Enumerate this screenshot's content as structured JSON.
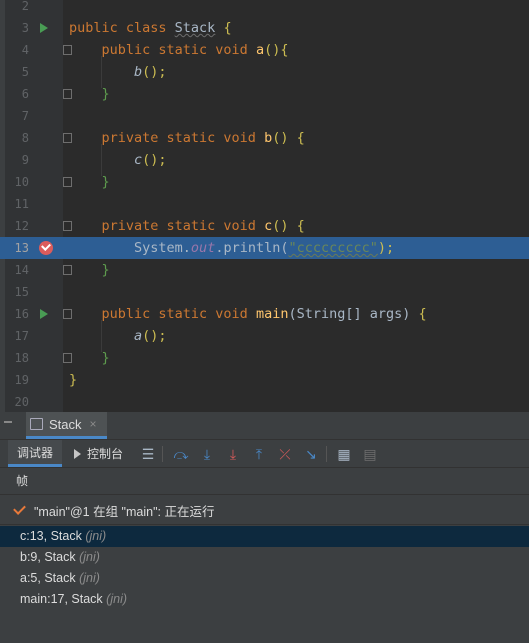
{
  "editor": {
    "lines": [
      {
        "num": "2",
        "tokens": []
      },
      {
        "num": "3",
        "marker": "run",
        "tokens": [
          {
            "t": "public class ",
            "c": "kw"
          },
          {
            "t": "Stack",
            "c": "wavy-cls"
          },
          {
            "t": " {",
            "c": "brace-y"
          }
        ]
      },
      {
        "num": "4",
        "fold": true,
        "tokens": [
          {
            "t": "    public static void ",
            "c": "kw"
          },
          {
            "t": "a",
            "c": "fn"
          },
          {
            "t": "(){",
            "c": "brace-y"
          }
        ]
      },
      {
        "num": "5",
        "tokens": [
          {
            "t": "        "
          },
          {
            "t": "b",
            "c": "it"
          },
          {
            "t": "();",
            "c": "brace-y"
          }
        ]
      },
      {
        "num": "6",
        "fold": true,
        "tokens": [
          {
            "t": "    "
          },
          {
            "t": "}",
            "c": "brace-g"
          }
        ]
      },
      {
        "num": "7",
        "tokens": []
      },
      {
        "num": "8",
        "fold": true,
        "tokens": [
          {
            "t": "    private static void ",
            "c": "kw"
          },
          {
            "t": "b",
            "c": "fn"
          },
          {
            "t": "() {",
            "c": "brace-y"
          }
        ]
      },
      {
        "num": "9",
        "tokens": [
          {
            "t": "        "
          },
          {
            "t": "c",
            "c": "it"
          },
          {
            "t": "();",
            "c": "brace-y"
          }
        ]
      },
      {
        "num": "10",
        "fold": true,
        "tokens": [
          {
            "t": "    "
          },
          {
            "t": "}",
            "c": "brace-g"
          }
        ]
      },
      {
        "num": "11",
        "tokens": []
      },
      {
        "num": "12",
        "fold": true,
        "tokens": [
          {
            "t": "    private static void ",
            "c": "kw"
          },
          {
            "t": "c",
            "c": "fn"
          },
          {
            "t": "() {",
            "c": "brace-y"
          }
        ]
      },
      {
        "num": "13",
        "marker": "breakpoint",
        "exec": true,
        "tokens": [
          {
            "t": "        System."
          },
          {
            "t": "out",
            "c": "fld"
          },
          {
            "t": ".println("
          },
          {
            "t": "\"ccccccccc\"",
            "c": "str wavy"
          },
          {
            "t": ");",
            "c": "brace-y"
          }
        ]
      },
      {
        "num": "14",
        "fold": true,
        "tokens": [
          {
            "t": "    "
          },
          {
            "t": "}",
            "c": "brace-g"
          }
        ]
      },
      {
        "num": "15",
        "tokens": []
      },
      {
        "num": "16",
        "marker": "run",
        "fold": true,
        "tokens": [
          {
            "t": "    public static void ",
            "c": "kw"
          },
          {
            "t": "main",
            "c": "fn"
          },
          {
            "t": "(String[] args) "
          },
          {
            "t": "{",
            "c": "brace-y"
          }
        ]
      },
      {
        "num": "17",
        "tokens": [
          {
            "t": "        "
          },
          {
            "t": "a",
            "c": "it"
          },
          {
            "t": "();",
            "c": "brace-y"
          }
        ]
      },
      {
        "num": "18",
        "fold": true,
        "tokens": [
          {
            "t": "    "
          },
          {
            "t": "}",
            "c": "brace-g"
          }
        ]
      },
      {
        "num": "19",
        "tokens": [
          {
            "t": "}",
            "c": "brace-y"
          }
        ]
      },
      {
        "num": "20",
        "tokens": []
      }
    ]
  },
  "debug": {
    "tab_label": "Stack",
    "tab_close": "×",
    "toolbar": {
      "debugger_label": "调试器",
      "console_label": "控制台"
    },
    "frames_header": "帧",
    "thread_text": "\"main\"@1 在组 \"main\": 正在运行",
    "frames": [
      {
        "text": "c:13, Stack",
        "pkg": "(jni)",
        "selected": true
      },
      {
        "text": "b:9, Stack",
        "pkg": "(jni)",
        "selected": false
      },
      {
        "text": "a:5, Stack",
        "pkg": "(jni)",
        "selected": false
      },
      {
        "text": "main:17, Stack",
        "pkg": "(jni)",
        "selected": false
      }
    ]
  },
  "colors": {
    "editor_bg": "#2b2b2b",
    "exec_line": "#2d5e94",
    "keyword": "#cc7832",
    "function": "#ffc66d",
    "string": "#6a8759",
    "accent": "#4a88c7"
  },
  "icons": [
    "run-gutter-icon",
    "breakpoint-icon",
    "fold-icon",
    "tab-icon",
    "console-icon",
    "threads-icon",
    "step-over-icon",
    "step-into-icon",
    "force-step-into-icon",
    "step-out-icon",
    "drop-frame-icon",
    "run-to-cursor-icon",
    "evaluate-icon",
    "trace-icon",
    "check-icon"
  ]
}
